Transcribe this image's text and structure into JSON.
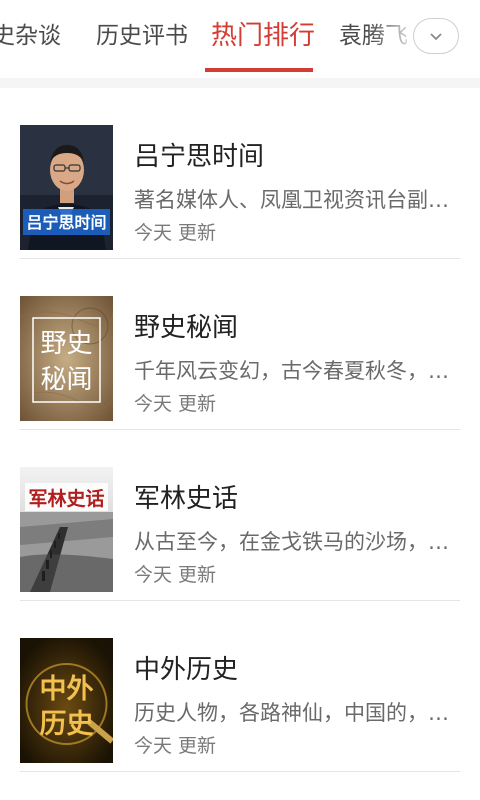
{
  "tabs": [
    {
      "label": "史杂谈"
    },
    {
      "label": "历史评书"
    },
    {
      "label": "热门排行",
      "active": true
    },
    {
      "label": "袁腾飞"
    }
  ],
  "colors": {
    "accent": "#d43c33",
    "text": "#222222",
    "subtext": "#6a6a6a"
  },
  "expand_icon": "chevron-down-icon",
  "items": [
    {
      "title": "吕宁思时间",
      "desc": "著名媒体人、凤凰卫视资讯台副台长吕宁思",
      "updated": "今天 更新",
      "cover_text": "吕宁思时间"
    },
    {
      "title": "野史秘闻",
      "desc": "千年风云变幻，古今春夏秋冬，尽在野史秘闻",
      "updated": "今天 更新",
      "cover_text_1": "野史",
      "cover_text_2": "秘闻"
    },
    {
      "title": "军林史话",
      "desc": "从古至今，在金戈铁马的沙场，在刀光剑影中",
      "updated": "今天 更新",
      "cover_text": "军林史话"
    },
    {
      "title": "中外历史",
      "desc": "历史人物，各路神仙，中国的，外国的故事",
      "updated": "今天 更新",
      "cover_text_1": "中外",
      "cover_text_2": "历史"
    }
  ]
}
